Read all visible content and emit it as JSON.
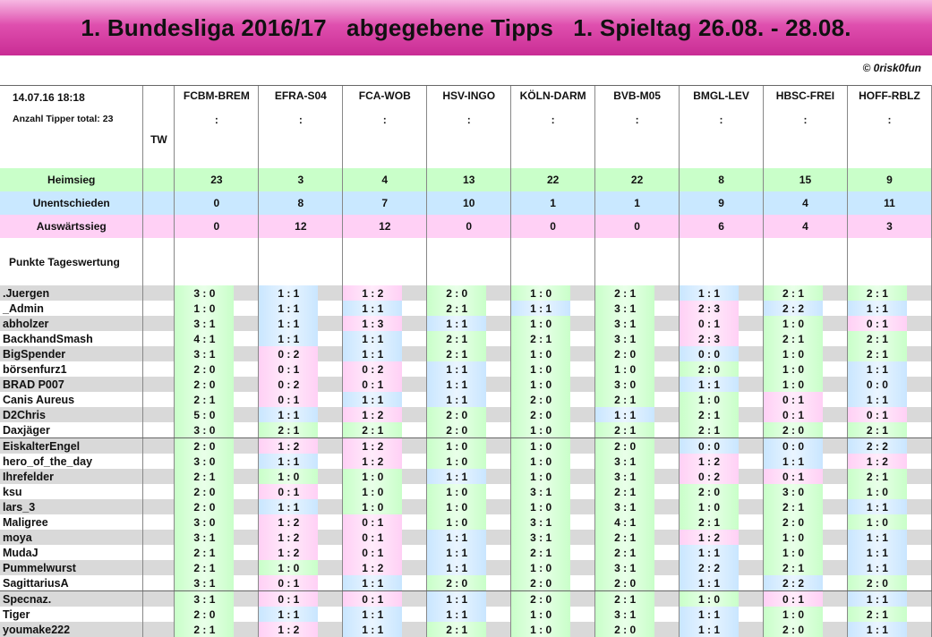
{
  "title": "1. Bundesliga 2016/17   abgegebene Tipps   1. Spieltag 26.08. - 28.08.",
  "copyright": "© 0risk0fun",
  "date": "14.07.16    18:18",
  "tipper_total": "Anzahl Tipper total: 23",
  "tw_label": "TW",
  "colon": ":",
  "matches": [
    "FCBM-BREM",
    "EFRA-S04",
    "FCA-WOB",
    "HSV-INGO",
    "KÖLN-DARM",
    "BVB-M05",
    "BMGL-LEV",
    "HBSC-FREI",
    "HOFF-RBLZ"
  ],
  "summary": [
    {
      "label": "Heimsieg",
      "values": [
        "23",
        "3",
        "4",
        "13",
        "22",
        "22",
        "8",
        "15",
        "9"
      ]
    },
    {
      "label": "Unentschieden",
      "values": [
        "0",
        "8",
        "7",
        "10",
        "1",
        "1",
        "9",
        "4",
        "11"
      ]
    },
    {
      "label": "Auswärtssieg",
      "values": [
        "0",
        "12",
        "12",
        "0",
        "0",
        "0",
        "6",
        "4",
        "3"
      ]
    }
  ],
  "punkte_label": "Punkte Tageswertung",
  "colors": {
    "home": "#c9ffc9",
    "draw": "#c9e8ff",
    "away": "#ffd0f5",
    "banner": "#d94ba8"
  },
  "tippers": [
    {
      "name": ".Juergen",
      "tips": [
        "3 : 0",
        "1 : 1",
        "1 : 2",
        "2 : 0",
        "1 : 0",
        "2 : 1",
        "1 : 1",
        "2 : 1",
        "2 : 1"
      ]
    },
    {
      "name": "_Admin",
      "tips": [
        "1 : 0",
        "1 : 1",
        "1 : 1",
        "2 : 1",
        "1 : 1",
        "3 : 1",
        "2 : 3",
        "2 : 2",
        "1 : 1"
      ]
    },
    {
      "name": "abholzer",
      "tips": [
        "3 : 1",
        "1 : 1",
        "1 : 3",
        "1 : 1",
        "1 : 0",
        "3 : 1",
        "0 : 1",
        "1 : 0",
        "0 : 1"
      ]
    },
    {
      "name": "BackhandSmash",
      "tips": [
        "4 : 1",
        "1 : 1",
        "1 : 1",
        "2 : 1",
        "2 : 1",
        "3 : 1",
        "2 : 3",
        "2 : 1",
        "2 : 1"
      ]
    },
    {
      "name": "BigSpender",
      "tips": [
        "3 : 1",
        "0 : 2",
        "1 : 1",
        "2 : 1",
        "1 : 0",
        "2 : 0",
        "0 : 0",
        "1 : 0",
        "2 : 1"
      ]
    },
    {
      "name": "börsenfurz1",
      "tips": [
        "2 : 0",
        "0 : 1",
        "0 : 2",
        "1 : 1",
        "1 : 0",
        "1 : 0",
        "2 : 0",
        "1 : 0",
        "1 : 1"
      ]
    },
    {
      "name": "BRAD P007",
      "tips": [
        "2 : 0",
        "0 : 2",
        "0 : 1",
        "1 : 1",
        "1 : 0",
        "3 : 0",
        "1 : 1",
        "1 : 0",
        "0 : 0"
      ]
    },
    {
      "name": "Canis Aureus",
      "tips": [
        "2 : 1",
        "0 : 1",
        "1 : 1",
        "1 : 1",
        "2 : 0",
        "2 : 1",
        "1 : 0",
        "0 : 1",
        "1 : 1"
      ]
    },
    {
      "name": "D2Chris",
      "tips": [
        "5 : 0",
        "1 : 1",
        "1 : 2",
        "2 : 0",
        "2 : 0",
        "1 : 1",
        "2 : 1",
        "0 : 1",
        "0 : 1"
      ]
    },
    {
      "name": "Daxjäger",
      "tips": [
        "3 : 0",
        "2 : 1",
        "2 : 1",
        "2 : 0",
        "1 : 0",
        "2 : 1",
        "2 : 1",
        "2 : 0",
        "2 : 1"
      ]
    },
    {
      "name": "EiskalterEngel",
      "tips": [
        "2 : 0",
        "1 : 2",
        "1 : 2",
        "1 : 0",
        "1 : 0",
        "2 : 0",
        "0 : 0",
        "0 : 0",
        "2 : 2"
      ]
    },
    {
      "name": "hero_of_the_day",
      "tips": [
        "3 : 0",
        "1 : 1",
        "1 : 2",
        "1 : 0",
        "1 : 0",
        "3 : 1",
        "1 : 2",
        "1 : 1",
        "1 : 2"
      ]
    },
    {
      "name": "Ihrefelder",
      "tips": [
        "2 : 1",
        "1 : 0",
        "1 : 0",
        "1 : 1",
        "1 : 0",
        "3 : 1",
        "0 : 2",
        "0 : 1",
        "2 : 1"
      ]
    },
    {
      "name": "ksu",
      "tips": [
        "2 : 0",
        "0 : 1",
        "1 : 0",
        "1 : 0",
        "3 : 1",
        "2 : 1",
        "2 : 0",
        "3 : 0",
        "1 : 0"
      ]
    },
    {
      "name": "lars_3",
      "tips": [
        "2 : 0",
        "1 : 1",
        "1 : 0",
        "1 : 0",
        "1 : 0",
        "3 : 1",
        "1 : 0",
        "2 : 1",
        "1 : 1"
      ]
    },
    {
      "name": "Maligree",
      "tips": [
        "3 : 0",
        "1 : 2",
        "0 : 1",
        "1 : 0",
        "3 : 1",
        "4 : 1",
        "2 : 1",
        "2 : 0",
        "1 : 0"
      ]
    },
    {
      "name": "moya",
      "tips": [
        "3 : 1",
        "1 : 2",
        "0 : 1",
        "1 : 1",
        "3 : 1",
        "2 : 1",
        "1 : 2",
        "1 : 0",
        "1 : 1"
      ]
    },
    {
      "name": "MudaJ",
      "tips": [
        "2 : 1",
        "1 : 2",
        "0 : 1",
        "1 : 1",
        "2 : 1",
        "2 : 1",
        "1 : 1",
        "1 : 0",
        "1 : 1"
      ]
    },
    {
      "name": "Pummelwurst",
      "tips": [
        "2 : 1",
        "1 : 0",
        "1 : 2",
        "1 : 1",
        "1 : 0",
        "3 : 1",
        "2 : 2",
        "2 : 1",
        "1 : 1"
      ]
    },
    {
      "name": "SagittariusA",
      "tips": [
        "3 : 1",
        "0 : 1",
        "1 : 1",
        "2 : 0",
        "2 : 0",
        "2 : 0",
        "1 : 1",
        "2 : 2",
        "2 : 0"
      ]
    },
    {
      "name": "Specnaz.",
      "tips": [
        "3 : 1",
        "0 : 1",
        "0 : 1",
        "1 : 1",
        "2 : 0",
        "2 : 1",
        "1 : 0",
        "0 : 1",
        "1 : 1"
      ]
    },
    {
      "name": "Tiger",
      "tips": [
        "2 : 0",
        "1 : 1",
        "1 : 1",
        "1 : 1",
        "1 : 0",
        "3 : 1",
        "1 : 1",
        "1 : 0",
        "2 : 1"
      ]
    },
    {
      "name": "youmake222",
      "tips": [
        "2 : 1",
        "1 : 2",
        "1 : 1",
        "2 : 1",
        "1 : 0",
        "2 : 0",
        "1 : 1",
        "2 : 0",
        "1 : 1"
      ]
    }
  ]
}
